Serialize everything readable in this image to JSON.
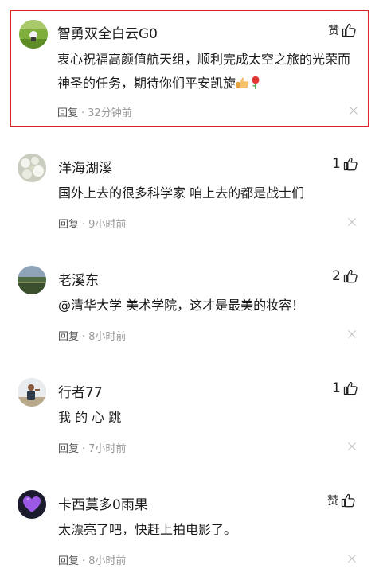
{
  "comments": [
    {
      "username": "智勇双全白云G0",
      "text": "衷心祝福高颜值航天组，顺利完成太空之旅的光荣而神圣的任务，期待你们平安凯旋",
      "reply_label": "回复",
      "time": "32分钟前",
      "like_label": "赞",
      "like_count": "",
      "highlighted": true,
      "emoji": [
        "thumbs-up-emoji",
        "rose-emoji"
      ],
      "avatar_icon": "grass-landscape-avatar"
    },
    {
      "username": "洋海湖溪",
      "text": "国外上去的很多科学家 咱上去的都是战士们",
      "reply_label": "回复",
      "time": "9小时前",
      "like_label": "",
      "like_count": "1",
      "avatar_icon": "white-flowers-avatar"
    },
    {
      "username": "老溪东",
      "text": "@清华大学 美术学院，这才是最美的妆容！",
      "reply_label": "回复",
      "time": "8小时前",
      "like_label": "",
      "like_count": "2",
      "avatar_icon": "field-landscape-avatar"
    },
    {
      "username": "行者77",
      "text": "我 的 心 跳",
      "reply_label": "回复",
      "time": "7小时前",
      "like_label": "",
      "like_count": "1",
      "avatar_icon": "person-photo-avatar"
    },
    {
      "username": "卡西莫多0雨果",
      "text": "太漂亮了吧，快赶上拍电影了。",
      "reply_label": "回复",
      "time": "8小时前",
      "like_label": "赞",
      "like_count": "",
      "avatar_icon": "purple-heart-avatar"
    }
  ],
  "colors": {
    "highlight_border": "#e02222",
    "meta_text": "#999999",
    "reply_text": "#555555"
  }
}
